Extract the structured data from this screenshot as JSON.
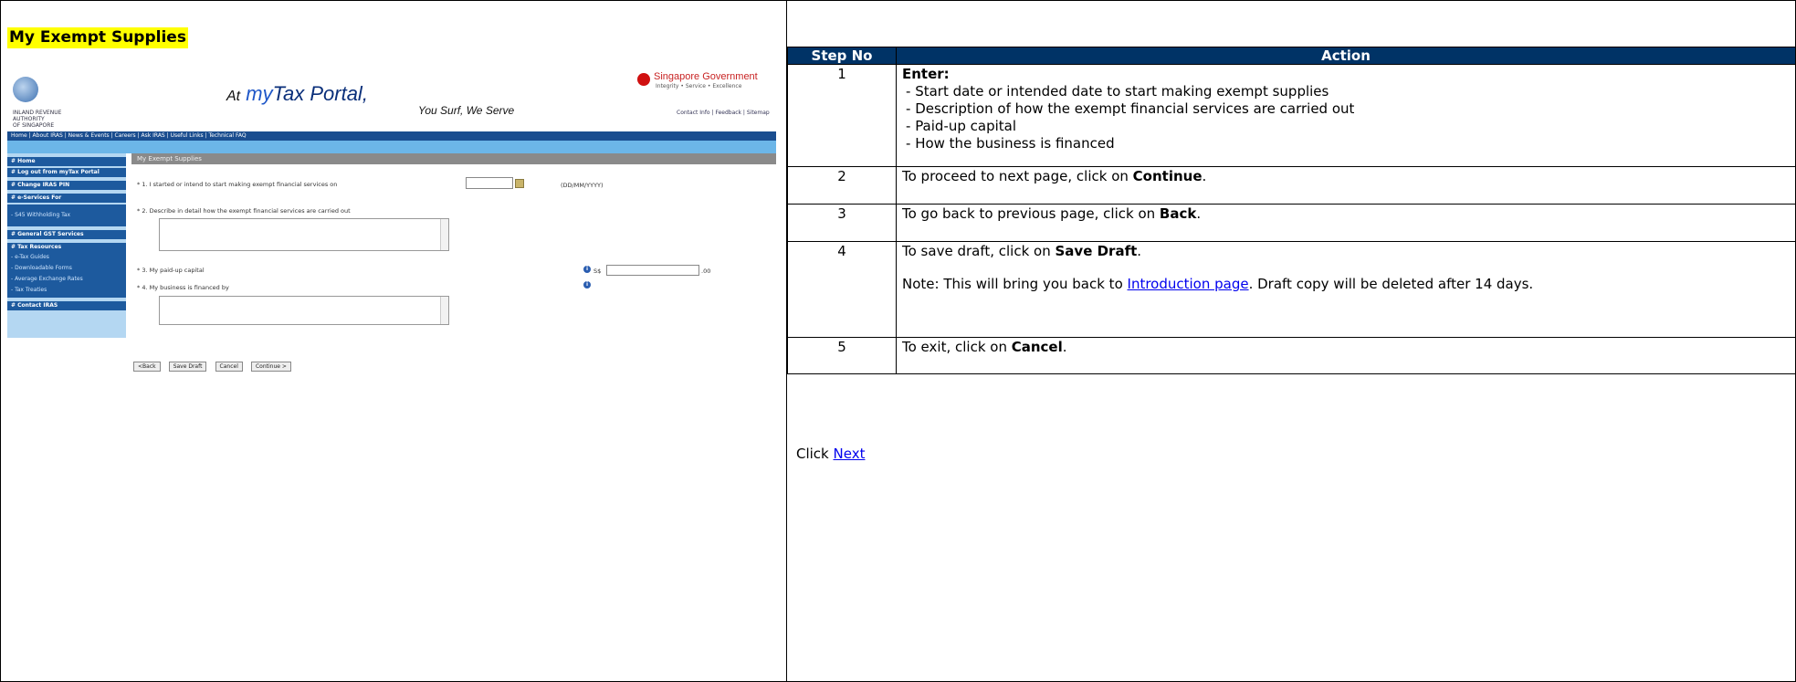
{
  "page_title": "My Exempt Supplies",
  "screenshot": {
    "logo_text": "INLAND REVENUE\nAUTHORITY\nOF SINGAPORE",
    "portal_at": "At",
    "portal_name_my": "my",
    "portal_name_rest": "Tax Portal",
    "portal_comma": ",",
    "tagline": "You Surf, We Serve",
    "gov_name": "Singapore Government",
    "gov_motto": "Integrity • Service • Excellence",
    "gov_links": "Contact Info | Feedback | Sitemap",
    "navbar": "Home  |  About IRAS  |  News & Events  |  Careers  |  Ask IRAS  |  Useful Links  |  Technical FAQ",
    "sidebar": [
      {
        "label": "# Home",
        "sub": false
      },
      {
        "label": "# Log out from myTax Portal",
        "sub": false
      },
      {
        "label": "# Change IRAS PIN",
        "sub": false
      },
      {
        "label": "# e-Services For",
        "sub": false
      },
      {
        "label": "- S45 Withholding Tax",
        "sub": true
      },
      {
        "label": "# General GST Services",
        "sub": false
      },
      {
        "label": "# Tax Resources",
        "sub": false
      },
      {
        "label": "- e-Tax Guides",
        "sub": true
      },
      {
        "label": "- Downloadable Forms",
        "sub": true
      },
      {
        "label": "- Average Exchange Rates",
        "sub": true
      },
      {
        "label": "- Tax Treaties",
        "sub": true
      },
      {
        "label": "# Contact IRAS",
        "sub": false
      }
    ],
    "content_header": "My Exempt Supplies",
    "q1": "* 1.   I started or intend to start making exempt financial services on",
    "q1_format": "(DD/MM/YYYY)",
    "q2": "* 2.  Describe in detail how the exempt financial services are carried out",
    "q3": "* 3.  My paid-up capital",
    "q3_currency": "S$",
    "q3_suffix": ".00",
    "q4": "* 4.  My business is financed by",
    "buttons": {
      "back": "<Back",
      "save_draft": "Save Draft",
      "cancel": "Cancel",
      "continue": "Continue >"
    }
  },
  "steps_table": {
    "headers": [
      "Step No",
      "Action"
    ],
    "step1": {
      "no": "1",
      "enter": "Enter:",
      "items": [
        "Start date or intended date to start making exempt supplies",
        "Description of how the exempt financial services are carried out",
        "Paid-up capital",
        "How the business is financed"
      ]
    },
    "step2": {
      "no": "2",
      "pre": "To proceed to next page, click on ",
      "bold": "Continue",
      "post": "."
    },
    "step3": {
      "no": "3",
      "pre": "To go back to previous page, click on ",
      "bold": "Back",
      "post": "."
    },
    "step4": {
      "no": "4",
      "pre": "To save draft, click on ",
      "bold": "Save Draft",
      "post": ".",
      "note_pre": "Note: This will bring you back to ",
      "note_link": "Introduction page",
      "note_post": ". Draft copy will be deleted after 14 days."
    },
    "step5": {
      "no": "5",
      "pre": "To exit, click on ",
      "bold": "Cancel",
      "post": "."
    }
  },
  "footer": {
    "click": "Click ",
    "next_link": "Next"
  }
}
